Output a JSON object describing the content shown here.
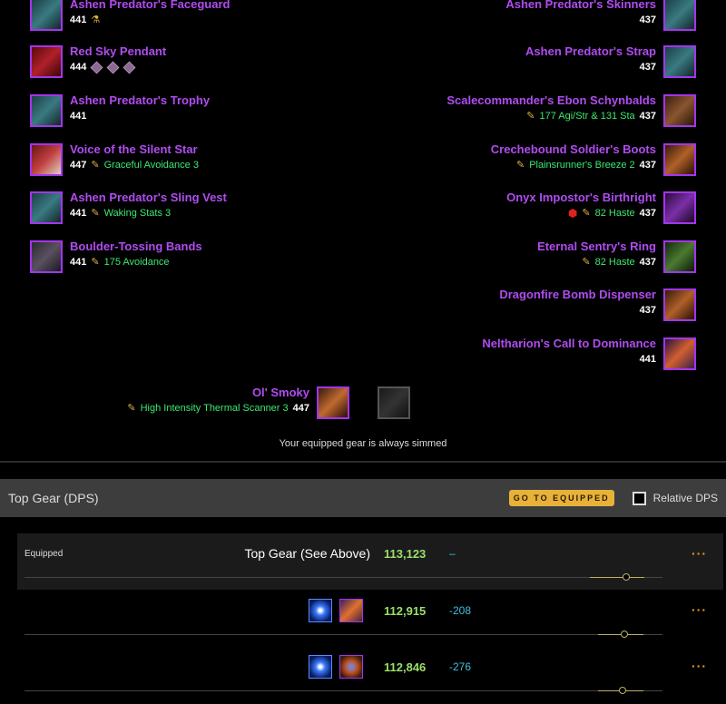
{
  "gear": {
    "left": [
      {
        "name": "Ashen Predator's Faceguard",
        "ilvl": "441",
        "enchant": "",
        "has_quill": false,
        "has_flask": true,
        "sockets": 0
      },
      {
        "name": "Red Sky Pendant",
        "ilvl": "444",
        "enchant": "",
        "has_quill": false,
        "has_flask": false,
        "sockets": 3
      },
      {
        "name": "Ashen Predator's Trophy",
        "ilvl": "441",
        "enchant": "",
        "has_quill": false,
        "has_flask": false,
        "sockets": 0
      },
      {
        "name": "Voice of the Silent Star",
        "ilvl": "447",
        "enchant": "Graceful Avoidance 3",
        "has_quill": true,
        "has_flask": false,
        "sockets": 0
      },
      {
        "name": "Ashen Predator's Sling Vest",
        "ilvl": "441",
        "enchant": "Waking Stats 3",
        "has_quill": true,
        "has_flask": false,
        "sockets": 0
      },
      {
        "name": "Boulder-Tossing Bands",
        "ilvl": "441",
        "enchant": "175 Avoidance",
        "has_quill": true,
        "has_flask": false,
        "sockets": 0
      }
    ],
    "right": [
      {
        "name": "Ashen Predator's Skinners",
        "ilvl": "437",
        "enchant": "",
        "has_quill": false,
        "has_gem": false
      },
      {
        "name": "Ashen Predator's Strap",
        "ilvl": "437",
        "enchant": "",
        "has_quill": false,
        "has_gem": false
      },
      {
        "name": "Scalecommander's Ebon Schynbalds",
        "ilvl": "437",
        "enchant": "177 Agi/Str & 131 Sta",
        "has_quill": true,
        "has_gem": false
      },
      {
        "name": "Crechebound Soldier's Boots",
        "ilvl": "437",
        "enchant": "Plainsrunner's Breeze 2",
        "has_quill": true,
        "has_gem": false
      },
      {
        "name": "Onyx Impostor's Birthright",
        "ilvl": "437",
        "enchant": "82 Haste",
        "has_quill": true,
        "has_gem": true
      },
      {
        "name": "Eternal Sentry's Ring",
        "ilvl": "437",
        "enchant": "82 Haste",
        "has_quill": true,
        "has_gem": false
      },
      {
        "name": "Dragonfire Bomb Dispenser",
        "ilvl": "437",
        "enchant": "",
        "has_quill": false,
        "has_gem": false
      },
      {
        "name": "Neltharion's Call to Dominance",
        "ilvl": "441",
        "enchant": "",
        "has_quill": false,
        "has_gem": false
      }
    ],
    "weapon": {
      "name": "Ol' Smoky",
      "ilvl": "447",
      "enchant": "High Intensity Thermal Scanner 3"
    },
    "note": "Your equipped gear is always simmed"
  },
  "top_gear": {
    "title": "Top Gear (DPS)",
    "goto_button": "GO TO EQUIPPED",
    "relative_label": "Relative DPS",
    "rows": [
      {
        "label": "Equipped",
        "title": "Top Gear (See Above)",
        "dps": "113,123",
        "diff": "–",
        "more": "···"
      },
      {
        "label": "",
        "title": "",
        "dps": "112,915",
        "diff": "-208",
        "more": "···",
        "icons": [
          "blue-gem-icon",
          "fire-item-icon"
        ]
      },
      {
        "label": "",
        "title": "",
        "dps": "112,846",
        "diff": "-276",
        "more": "···",
        "icons": [
          "blue-gem-icon",
          "orb-item-icon"
        ]
      }
    ]
  }
}
